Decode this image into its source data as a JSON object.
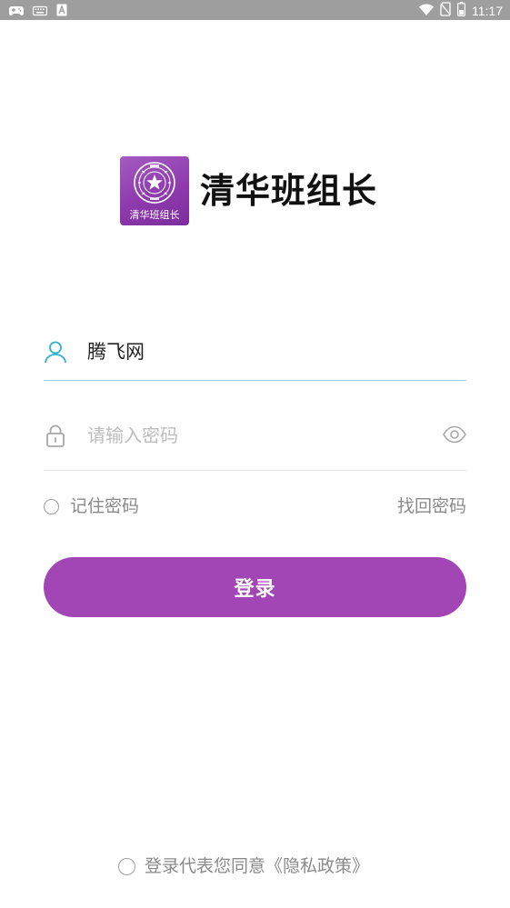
{
  "status_bar": {
    "time": "11:17",
    "left_icons": [
      "gamepad-icon",
      "keyboard-icon",
      "a-letter-icon"
    ],
    "right_icons": [
      "wifi-icon",
      "no-sim-icon",
      "battery-icon"
    ]
  },
  "logo": {
    "tile_label": "清华班组长",
    "title": "清华班组长"
  },
  "username": {
    "value": "腾飞网",
    "icon": "user-icon"
  },
  "password": {
    "placeholder": "请输入密码",
    "icon": "lock-icon",
    "toggle_icon": "eye-icon"
  },
  "options": {
    "remember_label": "记住密码",
    "forgot_label": "找回密码"
  },
  "login": {
    "label": "登录"
  },
  "agreement": {
    "label": "登录代表您同意《隐私政策》"
  },
  "colors": {
    "accent": "#a246b5",
    "username_icon": "#2bb3d6",
    "underline_active": "#8fd3e0",
    "muted_text": "#8a8a8a",
    "status_bar": "#9e9e9e"
  }
}
